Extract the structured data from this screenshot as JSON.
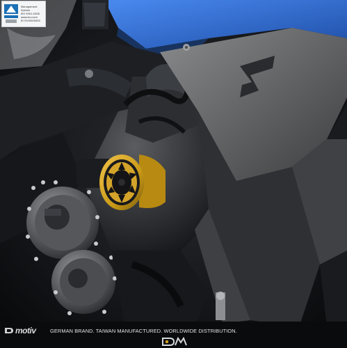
{
  "photo": {
    "subject": "motorcycle frame slider",
    "colors": {
      "accent_gold": "#c99a18",
      "bike_blue": "#2f6fd6",
      "panel_grey": "#6b6c6e",
      "frame_black": "#141518"
    }
  },
  "cert_badge": {
    "icon": "tuv-icon",
    "line1": "Management",
    "line2": "System",
    "line3": "ISO 9001:2008",
    "line4": "www.tuv.com",
    "line5": "ID 9105000000"
  },
  "footer": {
    "left_logo_icon": "dimotiv-mark-icon",
    "brand": "motiv",
    "tagline": "GERMAN BRAND. TAIWAN MANUFACTURED. WORLDWIDE DISTRIBUTION.",
    "right_logo_icon": "dmv-logo-icon"
  }
}
